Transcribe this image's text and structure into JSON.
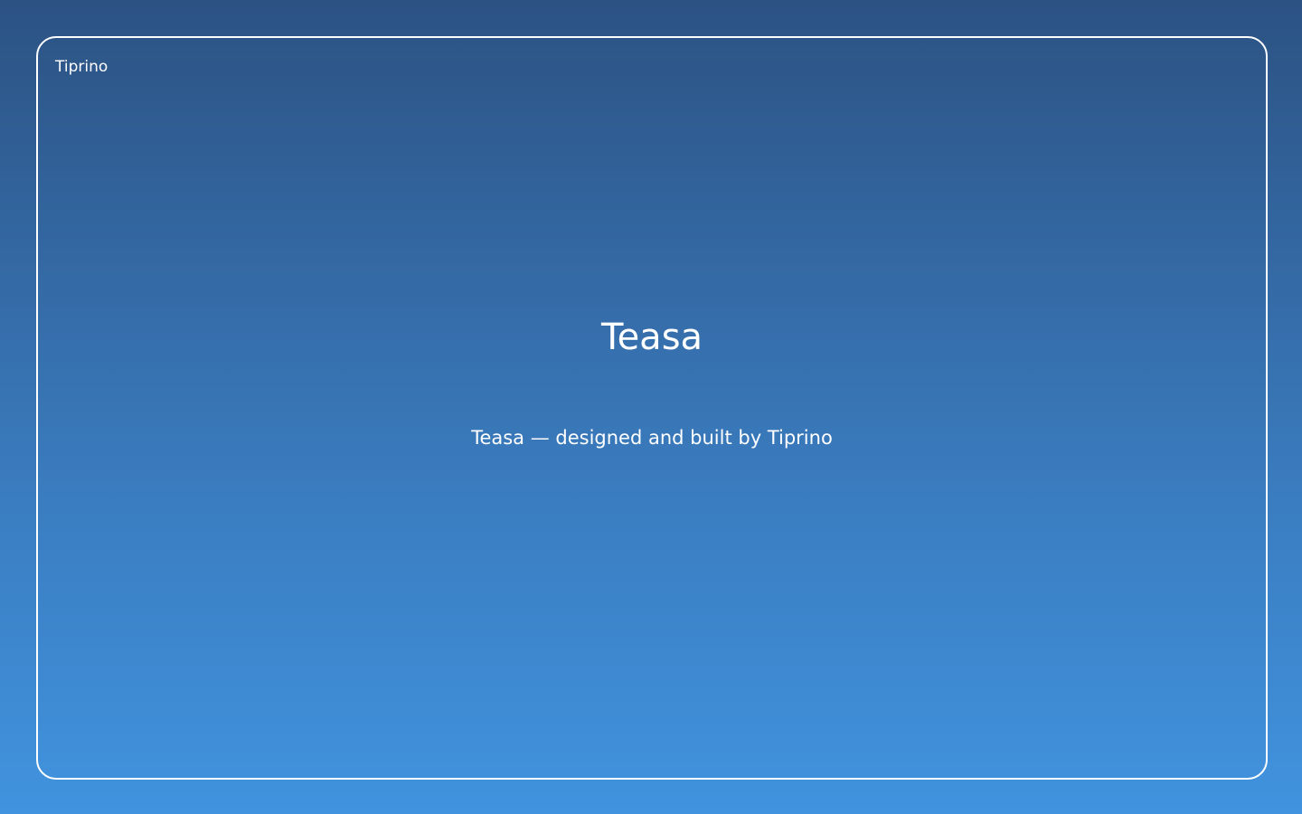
{
  "header": {
    "brand": "Tiprino"
  },
  "main": {
    "title": "Teasa",
    "subtitle": "Teasa — designed and built by Tiprino"
  },
  "colors": {
    "background_top": "#2c5283",
    "background_bottom": "#4193df",
    "frame": "#ffffff",
    "text": "#ffffff"
  }
}
